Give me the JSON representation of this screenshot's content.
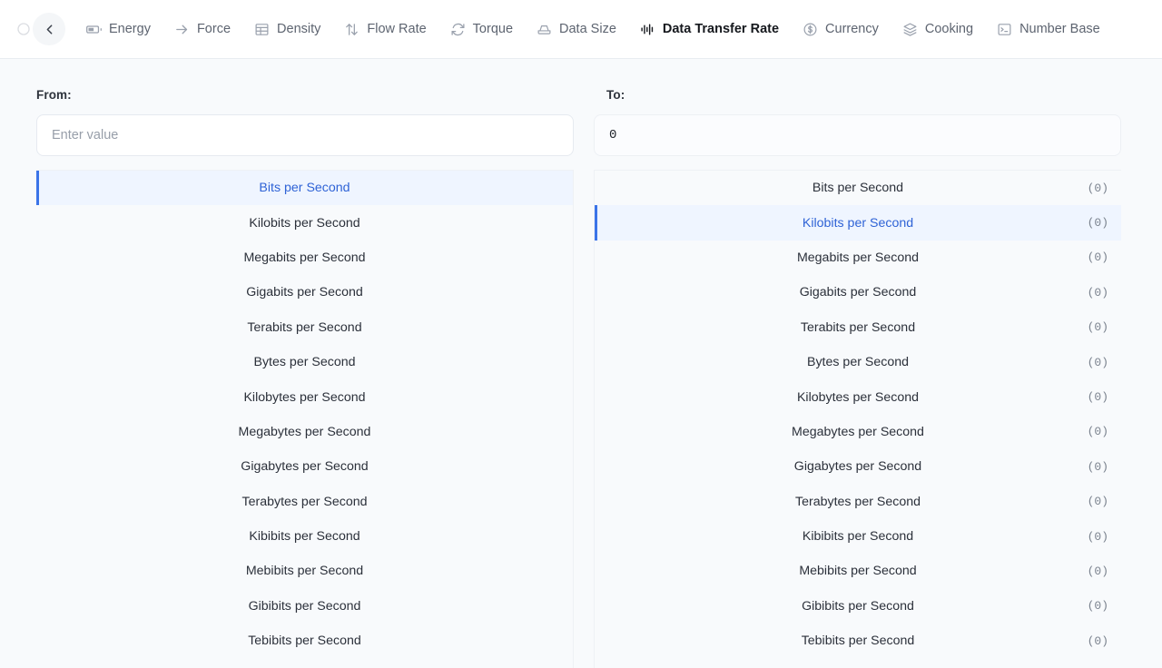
{
  "header": {
    "back_button_icon": "chevron-left-icon",
    "tabs": [
      {
        "label": "Energy",
        "icon": "battery-icon",
        "active": false
      },
      {
        "label": "Force",
        "icon": "arrow-right-icon",
        "active": false
      },
      {
        "label": "Density",
        "icon": "table-grid-icon",
        "active": false
      },
      {
        "label": "Flow Rate",
        "icon": "arrows-up-down-icon",
        "active": false
      },
      {
        "label": "Torque",
        "icon": "refresh-cw-icon",
        "active": false
      },
      {
        "label": "Data Size",
        "icon": "hard-drive-icon",
        "active": false
      },
      {
        "label": "Data Transfer Rate",
        "icon": "activity-wave-icon",
        "active": true
      },
      {
        "label": "Currency",
        "icon": "dollar-circle-icon",
        "active": false
      },
      {
        "label": "Cooking",
        "icon": "layers-icon",
        "active": false
      },
      {
        "label": "Number Base",
        "icon": "terminal-icon",
        "active": false
      }
    ]
  },
  "from_panel": {
    "label": "From:",
    "input_value": "",
    "input_placeholder": "Enter value",
    "selected_unit": "Bits per Second",
    "units": [
      "Bits per Second",
      "Kilobits per Second",
      "Megabits per Second",
      "Gigabits per Second",
      "Terabits per Second",
      "Bytes per Second",
      "Kilobytes per Second",
      "Megabytes per Second",
      "Gigabytes per Second",
      "Terabytes per Second",
      "Kibibits per Second",
      "Mebibits per Second",
      "Gibibits per Second",
      "Tebibits per Second"
    ]
  },
  "to_panel": {
    "label": "To:",
    "result_value": "0",
    "selected_unit": "Kilobits per Second",
    "units": [
      {
        "name": "Bits per Second",
        "value": "(0)"
      },
      {
        "name": "Kilobits per Second",
        "value": "(0)"
      },
      {
        "name": "Megabits per Second",
        "value": "(0)"
      },
      {
        "name": "Gigabits per Second",
        "value": "(0)"
      },
      {
        "name": "Terabits per Second",
        "value": "(0)"
      },
      {
        "name": "Bytes per Second",
        "value": "(0)"
      },
      {
        "name": "Kilobytes per Second",
        "value": "(0)"
      },
      {
        "name": "Megabytes per Second",
        "value": "(0)"
      },
      {
        "name": "Gigabytes per Second",
        "value": "(0)"
      },
      {
        "name": "Terabytes per Second",
        "value": "(0)"
      },
      {
        "name": "Kibibits per Second",
        "value": "(0)"
      },
      {
        "name": "Mebibits per Second",
        "value": "(0)"
      },
      {
        "name": "Gibibits per Second",
        "value": "(0)"
      },
      {
        "name": "Tebibits per Second",
        "value": "(0)"
      }
    ]
  },
  "colors": {
    "page_background": "#f8fafc",
    "header_background": "#ffffff",
    "accent_selected": "#3b74e8",
    "accent_selected_text": "#2f63d6",
    "selected_row_background": "#eff5ff",
    "active_tab": "#15181d",
    "muted_text": "#5d6470"
  }
}
